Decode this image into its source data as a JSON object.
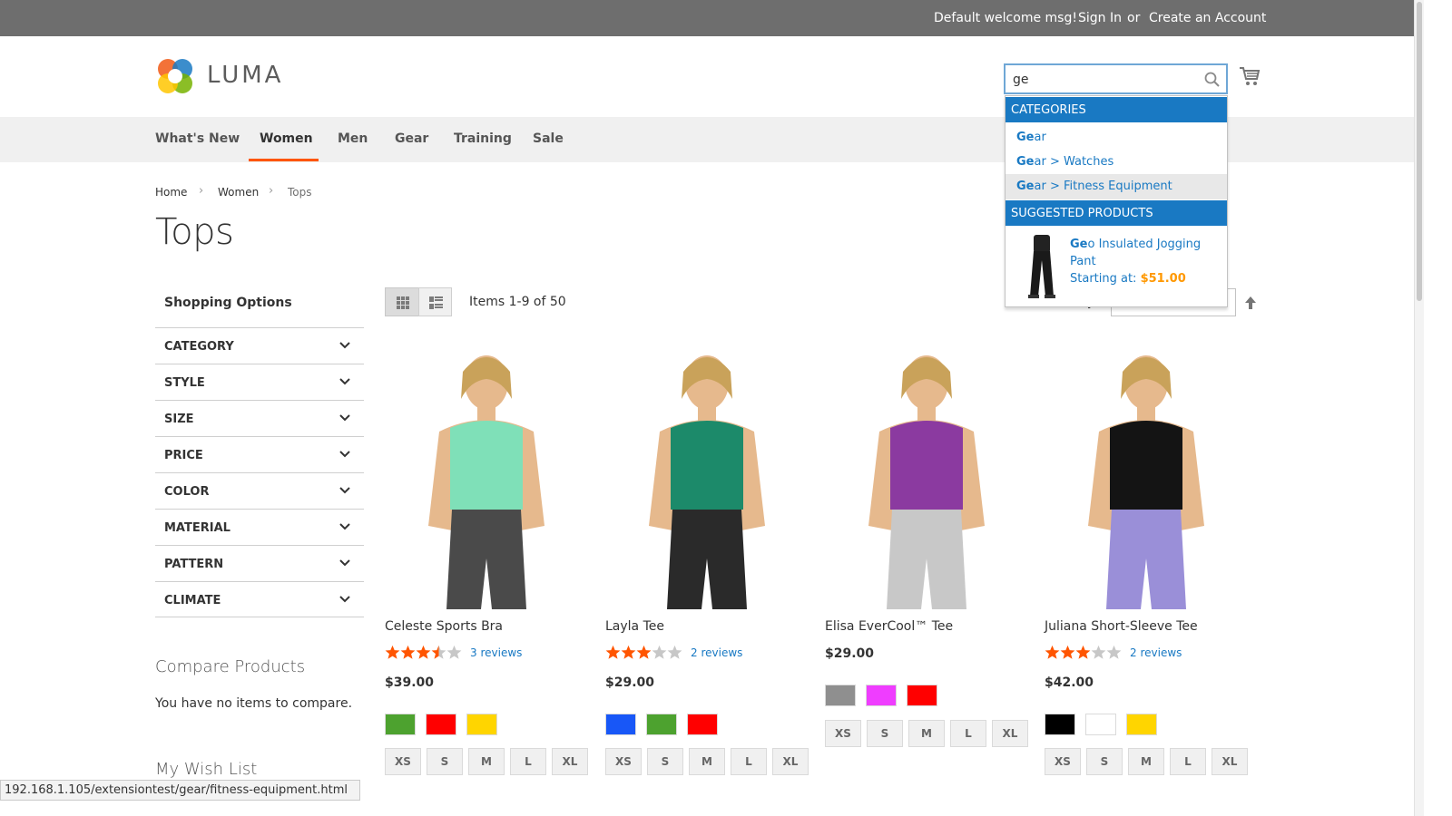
{
  "header": {
    "welcome": "Default welcome msg!",
    "sign_in": "Sign In",
    "or": "or",
    "create_account": "Create an Account",
    "logo_text": "LUMA",
    "search_value": "ge"
  },
  "nav": {
    "items": [
      {
        "label": "What's New"
      },
      {
        "label": "Women",
        "active": true
      },
      {
        "label": "Men"
      },
      {
        "label": "Gear"
      },
      {
        "label": "Training"
      },
      {
        "label": "Sale"
      }
    ]
  },
  "breadcrumb": {
    "items": [
      "Home",
      "Women",
      "Tops"
    ],
    "separator": "›"
  },
  "page_title": "Tops",
  "sidebar": {
    "shopping_options": "Shopping Options",
    "filters": [
      "CATEGORY",
      "STYLE",
      "SIZE",
      "PRICE",
      "COLOR",
      "MATERIAL",
      "PATTERN",
      "CLIMATE"
    ],
    "compare_title": "Compare Products",
    "compare_text": "You have no items to compare.",
    "wishlist_title": "My Wish List"
  },
  "toolbar": {
    "items_count": "Items 1-9 of 50",
    "sort_label": "y"
  },
  "products": [
    {
      "name": "Celeste Sports Bra",
      "rating": 3.5,
      "reviews": "3 reviews",
      "price": "$39.00",
      "colors": [
        "#4da22f",
        "#ff0000",
        "#ffd500"
      ],
      "sizes": [
        "XS",
        "S",
        "M",
        "L",
        "XL"
      ],
      "top_color": "#7fe0b8",
      "bottom_color": "#4a4a4a"
    },
    {
      "name": "Layla Tee",
      "rating": 3,
      "reviews": "2 reviews",
      "price": "$29.00",
      "colors": [
        "#1857f7",
        "#4da22f",
        "#ff0000"
      ],
      "sizes": [
        "XS",
        "S",
        "M",
        "L",
        "XL"
      ],
      "top_color": "#1c8a6a",
      "bottom_color": "#2a2a2a"
    },
    {
      "name": "Elisa EverCool™ Tee",
      "rating": 0,
      "reviews": "",
      "price": "$29.00",
      "colors": [
        "#8f8f8f",
        "#ef3dff",
        "#ff0000"
      ],
      "sizes": [
        "XS",
        "S",
        "M",
        "L",
        "XL"
      ],
      "top_color": "#8b3aa0",
      "bottom_color": "#c8c8c8"
    },
    {
      "name": "Juliana Short-Sleeve Tee",
      "rating": 3,
      "reviews": "2 reviews",
      "price": "$42.00",
      "colors": [
        "#000000",
        "#ffffff",
        "#ffd500"
      ],
      "sizes": [
        "XS",
        "S",
        "M",
        "L",
        "XL"
      ],
      "top_color": "#141414",
      "bottom_color": "#9a8fd8"
    }
  ],
  "autocomplete": {
    "categories_header": "CATEGORIES",
    "categories": [
      {
        "match": "Ge",
        "rest": "ar"
      },
      {
        "match": "Ge",
        "rest": "ar > Watches"
      },
      {
        "match": "Ge",
        "rest": "ar > Fitness Equipment"
      }
    ],
    "products_header": "SUGGESTED PRODUCTS",
    "product_match": "Ge",
    "product_rest": "o Insulated Jogging Pant",
    "starting_at": "Starting at: ",
    "product_price": "$51.00"
  },
  "status_url": "192.168.1.105/extensiontest/gear/fitness-equipment.html",
  "colors": {
    "accent": "#ff5501",
    "link": "#1979c3",
    "star": "#ff5501",
    "topbar": "#6e6e6e"
  }
}
